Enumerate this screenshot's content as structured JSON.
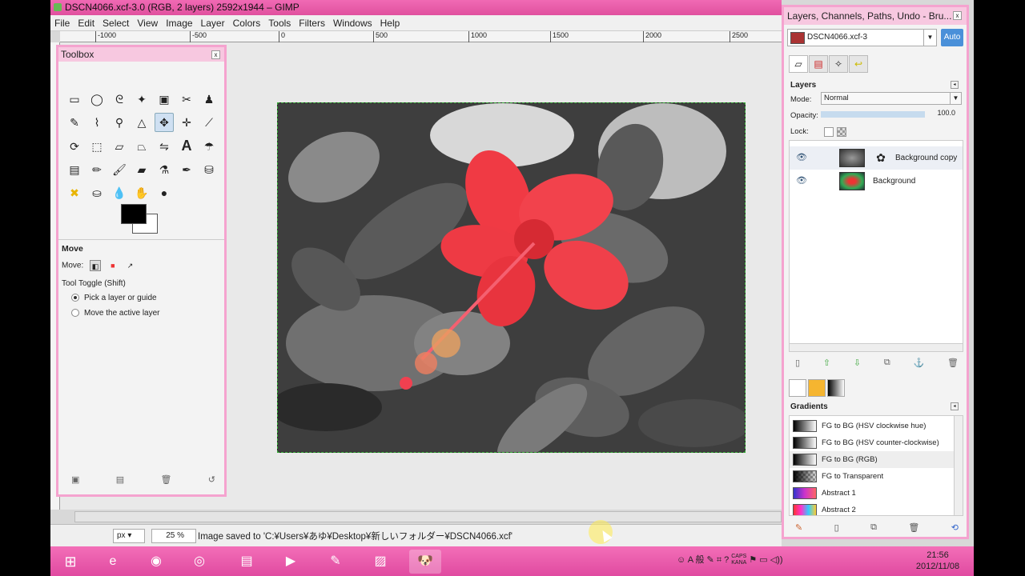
{
  "window": {
    "title": "DSCN4066.xcf-3.0 (RGB, 2 layers) 2592x1944 – GIMP",
    "menu": [
      "File",
      "Edit",
      "Select",
      "View",
      "Image",
      "Layer",
      "Colors",
      "Tools",
      "Filters",
      "Windows",
      "Help"
    ]
  },
  "ruler": {
    "ticks": [
      "-1000",
      "-500",
      "0",
      "500",
      "1000",
      "1500",
      "2000",
      "2500"
    ]
  },
  "status": {
    "unit": "px",
    "zoom": "25 %",
    "message": "Image saved to 'C:¥Users¥あゆ¥Desktop¥新しいフォルダー¥DSCN4066.xcf'"
  },
  "toolbox": {
    "title": "Toolbox",
    "tools": [
      "rect-select",
      "ellipse-select",
      "free-select",
      "fuzzy-select",
      "color-select",
      "scissors",
      "foreground-select",
      "paths",
      "color-picker",
      "zoom",
      "measure",
      "move",
      "align",
      "crop",
      "rotate",
      "scale",
      "shear",
      "perspective",
      "flip",
      "cage",
      "text",
      "heal-clone",
      "blend",
      "pencil",
      "paintbrush",
      "eraser",
      "airbrush",
      "ink",
      "clone",
      "perspective-clone",
      "smudge",
      "blur",
      "dodge",
      "bucket-fill"
    ],
    "options_title": "Move",
    "move_label": "Move:",
    "toggle_label": "Tool Toggle  (Shift)",
    "radio_1": "Pick a layer or guide",
    "radio_2": "Move the active layer"
  },
  "dock": {
    "title": "Layers, Channels, Paths, Undo - Bru...",
    "image_select": "DSCN4066.xcf-3",
    "auto_label": "Auto",
    "layers_head": "Layers",
    "mode_label": "Mode:",
    "mode_value": "Normal",
    "opacity_label": "Opacity:",
    "opacity_value": "100.0",
    "lock_label": "Lock:",
    "layers": [
      {
        "name": "Background copy"
      },
      {
        "name": "Background"
      }
    ],
    "gradients_head": "Gradients",
    "gradients": [
      {
        "name": "FG to BG (HSV clockwise hue)"
      },
      {
        "name": "FG to BG (HSV counter-clockwise)"
      },
      {
        "name": "FG to BG (RGB)"
      },
      {
        "name": "FG to Transparent"
      },
      {
        "name": "Abstract 1"
      },
      {
        "name": "Abstract 2"
      }
    ]
  },
  "taskbar": {
    "tray_text": "A 般",
    "tray_caps": "CAPS",
    "tray_kana": "KANA",
    "time": "21:56",
    "date": "2012/11/08"
  },
  "colors": {
    "accent": "#e04aa0",
    "flower": "#f0303a"
  }
}
